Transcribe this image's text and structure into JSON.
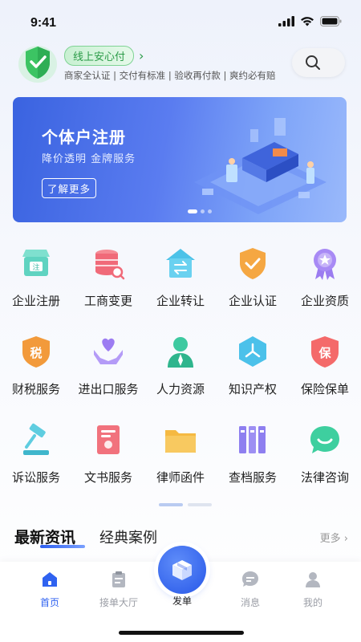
{
  "status_bar": {
    "time": "9:41"
  },
  "trust": {
    "badge": "线上安心付",
    "subtitle": "商家全认证 | 交付有标准 | 验收再付款 | 爽约必有赔"
  },
  "banner": {
    "title": "个体户注册",
    "subtitle": "降价透明 金牌服务",
    "button": "了解更多"
  },
  "services": [
    [
      {
        "label": "企业注册",
        "icon": "store-icon"
      },
      {
        "label": "工商变更",
        "icon": "database-search-icon"
      },
      {
        "label": "企业转让",
        "icon": "transfer-house-icon"
      },
      {
        "label": "企业认证",
        "icon": "shield-check-icon"
      },
      {
        "label": "企业资质",
        "icon": "award-icon"
      }
    ],
    [
      {
        "label": "财税服务",
        "icon": "tax-shield-icon"
      },
      {
        "label": "进出口服务",
        "icon": "heart-hands-icon"
      },
      {
        "label": "人力资源",
        "icon": "person-icon"
      },
      {
        "label": "知识产权",
        "icon": "hexagon-icon"
      },
      {
        "label": "保险保单",
        "icon": "insurance-shield-icon"
      }
    ],
    [
      {
        "label": "诉讼服务",
        "icon": "gavel-icon"
      },
      {
        "label": "文书服务",
        "icon": "document-icon"
      },
      {
        "label": "律师函件",
        "icon": "folder-icon"
      },
      {
        "label": "查档服务",
        "icon": "archive-icon"
      },
      {
        "label": "法律咨询",
        "icon": "chat-bubble-icon"
      }
    ]
  ],
  "news": {
    "tab_active": "最新资讯",
    "tab_other": "经典案例",
    "more": "更多"
  },
  "tabbar": {
    "home": "首页",
    "orders": "接单大厅",
    "publish": "发单",
    "messages": "消息",
    "mine": "我的"
  },
  "colors": {
    "accent": "#2f62f0",
    "green": "#2b9b48",
    "banner": "#3a63e0"
  }
}
